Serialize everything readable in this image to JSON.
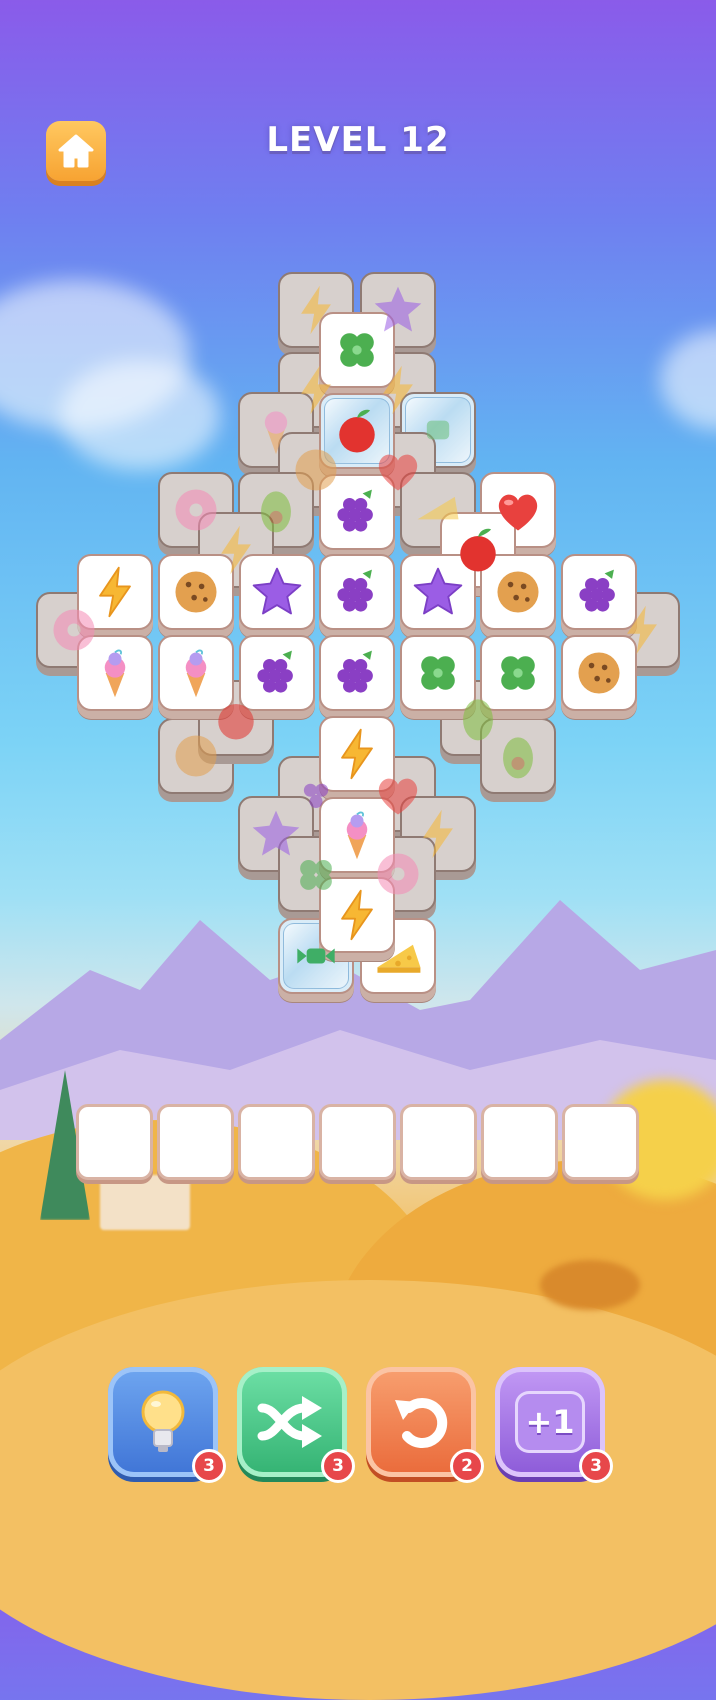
{
  "header": {
    "home_icon": "home-icon",
    "level_title": "LEVEL 12"
  },
  "tray": {
    "slot_count": 7
  },
  "boosters": [
    {
      "name": "hint",
      "icon": "lightbulb-icon",
      "count": "3",
      "color": "#4d86e0"
    },
    {
      "name": "shuffle",
      "icon": "shuffle-icon",
      "count": "3",
      "color": "#3fbf82"
    },
    {
      "name": "undo",
      "icon": "undo-icon",
      "count": "2",
      "color": "#ef7a4a"
    },
    {
      "name": "extra-slot",
      "icon": "plus-one-icon",
      "label": "+1",
      "count": "3",
      "color": "#9b6ae0"
    }
  ],
  "tile_types": [
    "lightning",
    "star",
    "clover",
    "apple",
    "grapes",
    "ice-cream",
    "cookie",
    "donut",
    "heart",
    "cheese",
    "avocado",
    "candy"
  ],
  "colors": {
    "tile_border": "#b99085",
    "badge": "#e7474a",
    "home_button": "#f7a332"
  }
}
